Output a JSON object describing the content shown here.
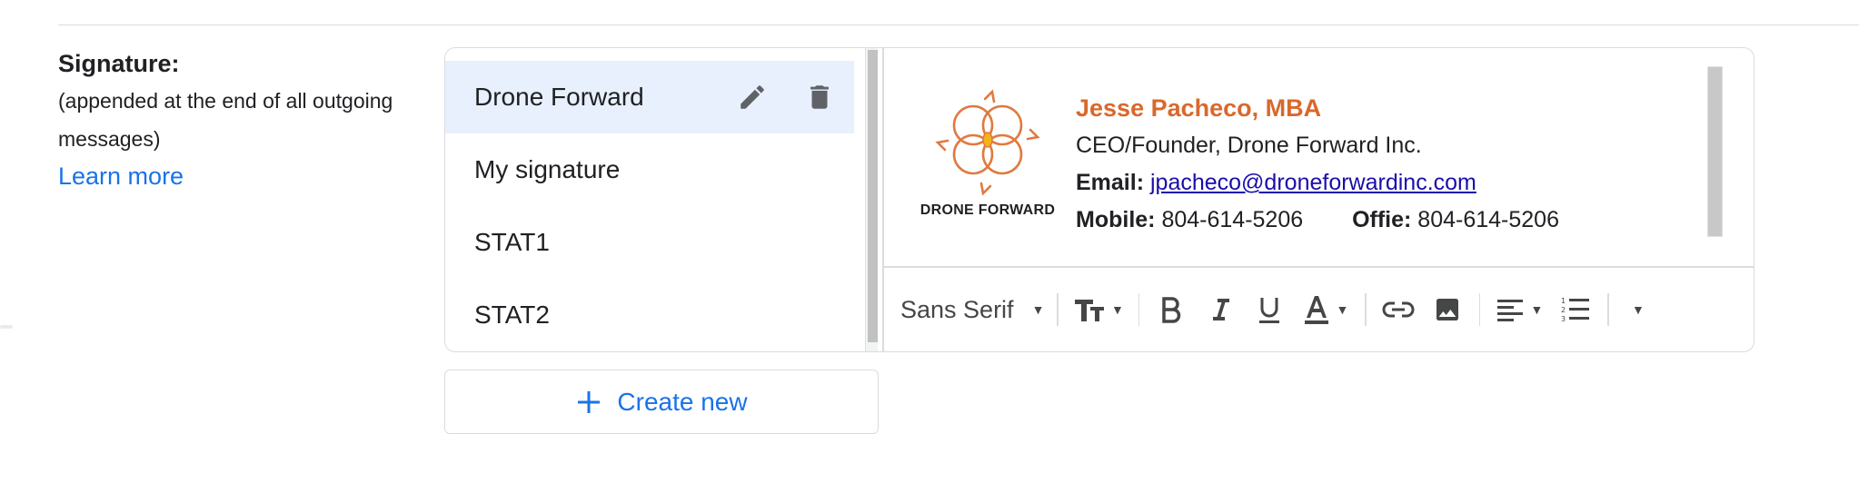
{
  "signature_section": {
    "title": "Signature:",
    "subtitle_line1": "(appended at the end of all outgoing",
    "subtitle_line2": "messages)",
    "learn_more": "Learn more"
  },
  "signatures": [
    {
      "label": "Drone Forward",
      "selected": true
    },
    {
      "label": "My signature",
      "selected": false
    },
    {
      "label": "STAT1",
      "selected": false
    },
    {
      "label": "STAT2",
      "selected": false
    }
  ],
  "item_actions": {
    "edit_icon": "pencil-icon",
    "delete_icon": "trash-icon"
  },
  "preview": {
    "logo_caption": "DRONE FORWARD",
    "name": "Jesse Pacheco, MBA",
    "title": "CEO/Founder, Drone Forward Inc.",
    "email_label": "Email:",
    "email_value": "jpacheco@droneforwardinc.com",
    "mobile_label": "Mobile:",
    "mobile_value": "804-614-5206",
    "office_label": "Offie:",
    "office_value": "804-614-5206"
  },
  "toolbar": {
    "font_family": "Sans Serif",
    "icons": [
      "text-size-icon",
      "bold-icon",
      "italic-icon",
      "underline-icon",
      "text-color-icon",
      "link-icon",
      "image-icon",
      "align-icon",
      "numbered-list-icon",
      "more-formatting-icon"
    ]
  },
  "create_new": {
    "label": "Create new",
    "icon": "plus-icon"
  },
  "colors": {
    "accent": "#1a73e8",
    "selected_bg": "#e8f0fe",
    "brand_orange": "#d9682c",
    "link": "#1a0dab"
  }
}
